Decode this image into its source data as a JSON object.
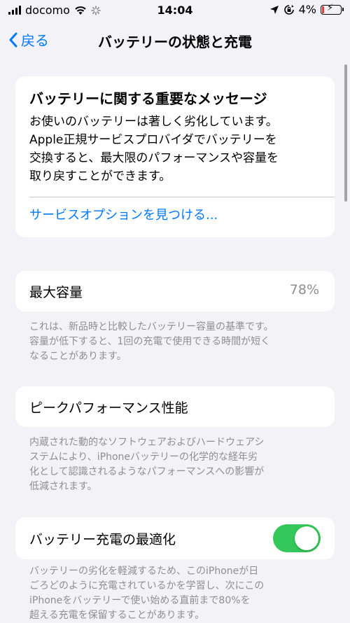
{
  "status_bar": {
    "carrier": "docomo",
    "time": "14:04",
    "battery_percent": "4%",
    "battery_level": 0.04
  },
  "nav": {
    "back_label": "戻る",
    "title": "バッテリーの状態と充電"
  },
  "message": {
    "title": "バッテリーに関する重要なメッセージ",
    "lines": [
      "お使いのバッテリーは著しく劣化しています。",
      "Apple正規サービスプロバイダでバッテリーを",
      "交換すると、最大限のパフォーマンスや容量を",
      "取り戻すことができます。"
    ],
    "link": "サービスオプションを見つける..."
  },
  "max_capacity": {
    "label": "最大容量",
    "value": "78%",
    "footnote": [
      "これは、新品時と比較したバッテリー容量の基準です。",
      "容量が低下すると、1回の充電で使用できる時間が短く",
      "なることがあります。"
    ]
  },
  "peak_performance": {
    "label": "ピークパフォーマンス性能",
    "footnote": [
      "内蔵された動的なソフトウェアおよびハードウェアシ",
      "ステムにより、iPhoneバッテリーの化学的な経年劣",
      "化として認識されるようなパフォーマンスへの影響が",
      "低減されます。"
    ]
  },
  "optimized_charging": {
    "label": "バッテリー充電の最適化",
    "enabled": true,
    "footnote": [
      "バッテリーの劣化を軽減するため、このiPhoneが日",
      "ごろどのように充電されているかを学習し、次にこの",
      "iPhoneをバッテリーで使い始める直前まで80%を",
      "超える充電を保留することがあります。"
    ]
  },
  "colors": {
    "accent": "#007aff",
    "toggle_on": "#34c759",
    "battery_low": "#e53935",
    "background": "#f2f2f7"
  }
}
